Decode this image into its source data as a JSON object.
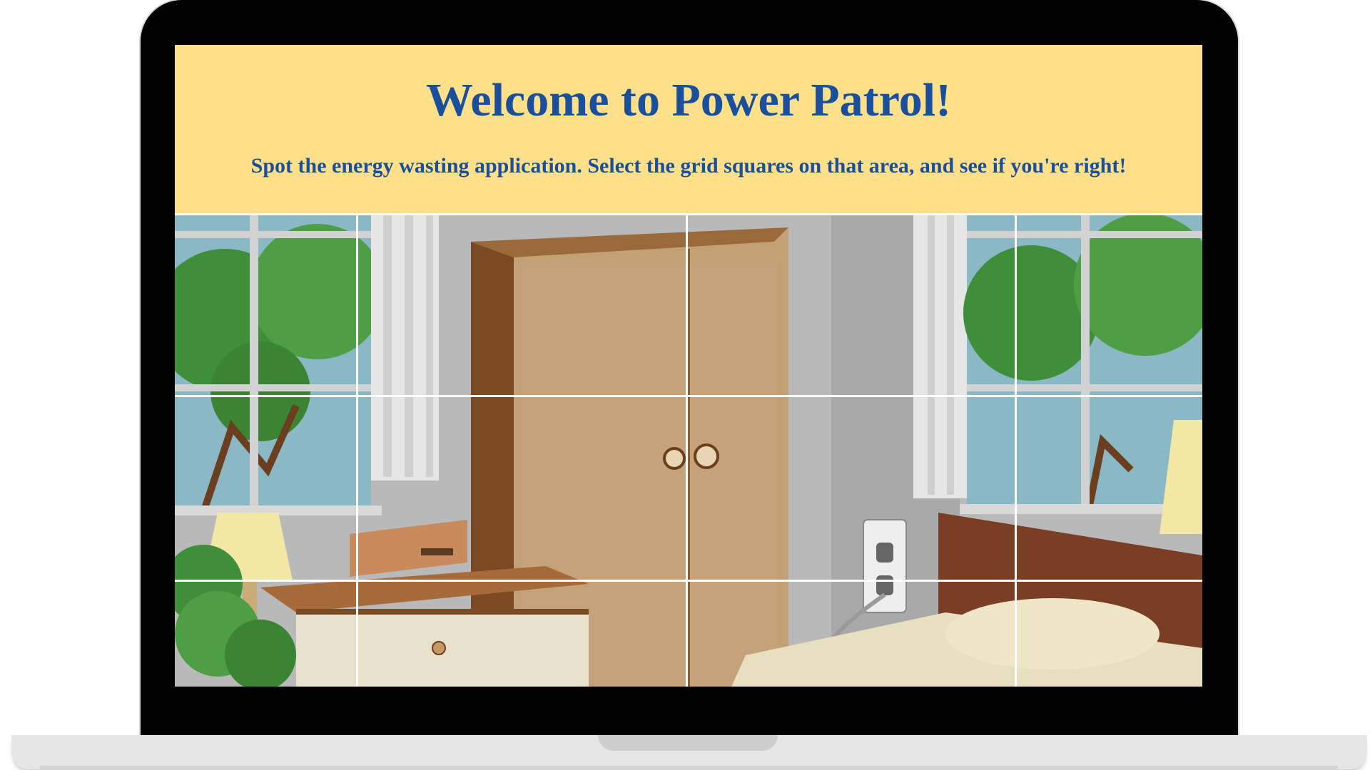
{
  "page": {
    "title": "Welcome to Power Patrol!",
    "subtitle": "Spot the energy wasting application. Select the grid squares on that area, and see if you're right!"
  },
  "colors": {
    "header_bg": "#ffe08a",
    "title_text": "#1a4f9c",
    "grid_lines": "#ffffff"
  },
  "grid": {
    "rows": 3,
    "columns": 4,
    "cell_names": [
      "r1c1",
      "r1c2",
      "r1c3",
      "r1c4",
      "r2c1",
      "r2c2",
      "r2c3",
      "r2c4",
      "r3c1",
      "r3c2",
      "r3c3",
      "r3c4"
    ]
  },
  "scene": {
    "description_items": [
      "window-left",
      "curtain-left",
      "wardrobe",
      "wall-outlet",
      "phone-charger",
      "window-right",
      "lamp-left",
      "lamp-right",
      "nightstand",
      "bed",
      "plant"
    ]
  }
}
